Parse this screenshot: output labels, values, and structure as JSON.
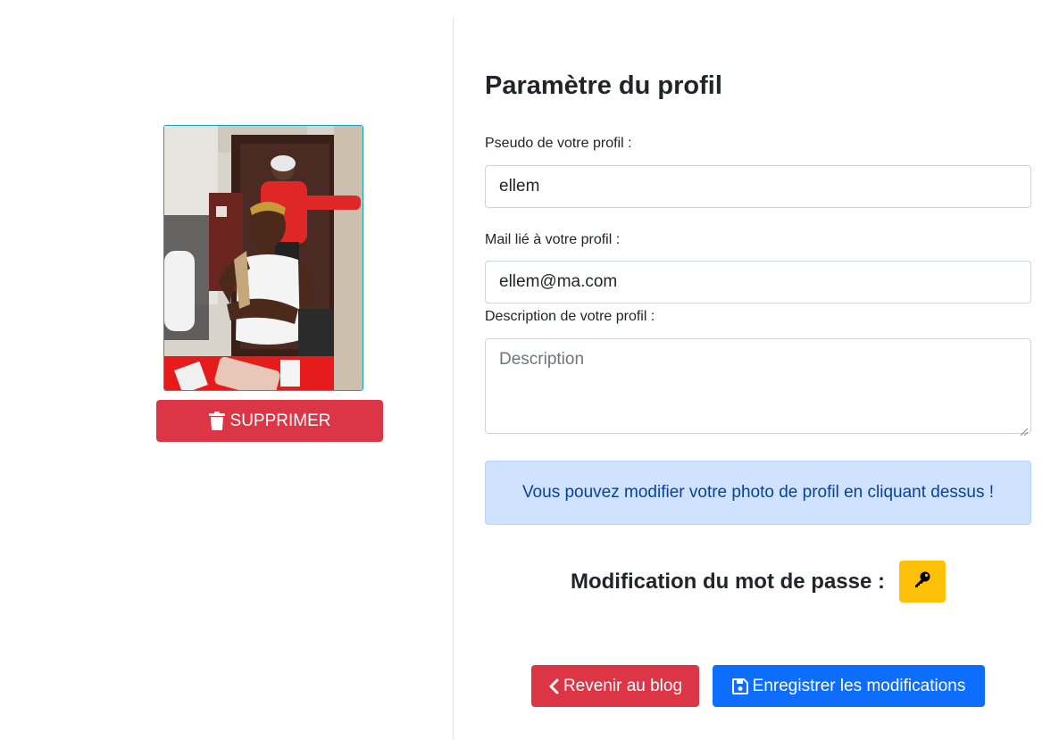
{
  "left_panel": {
    "delete_button": {
      "label": "SUPPRIMER",
      "icon": "trash-icon"
    },
    "photo": {
      "alt": "profile-photo"
    }
  },
  "form": {
    "title": "Paramètre du profil",
    "pseudo": {
      "label": "Pseudo de votre profil :",
      "value": "ellem"
    },
    "mail": {
      "label": "Mail lié à votre profil :",
      "value": "ellem@ma.com"
    },
    "description": {
      "label": "Description de votre profil :",
      "value": "",
      "placeholder": "Description"
    },
    "info_alert": "Vous pouvez modifier votre photo de profil en cliquant dessus !",
    "password": {
      "label": "Modification du mot de passe :",
      "icon": "key-icon"
    }
  },
  "actions": {
    "back_label": "Revenir au blog",
    "back_icon": "chevron-left-icon",
    "save_label": "Enregistrer les modifications",
    "save_icon": "floppy-disk-icon"
  },
  "colors": {
    "danger": "#dc3545",
    "primary": "#0d6efd",
    "warning": "#ffc107",
    "info_bg": "#cfe2ff",
    "info_text": "#084298"
  }
}
